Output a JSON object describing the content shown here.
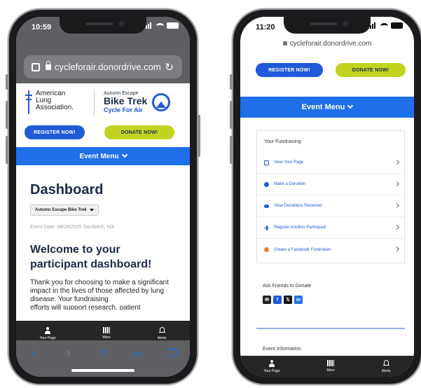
{
  "colors": {
    "brand_blue": "#1f5ad8",
    "event_menu_blue": "#1f6fe8",
    "donate_green": "#c2d421",
    "navy_text": "#1b2a48",
    "tab_bar": "#262626"
  },
  "phone1": {
    "status": {
      "time": "10:59"
    },
    "address": {
      "url": "cycleforair.donordrive.com",
      "page_icon": "page-icon",
      "lock_icon": "lock-icon",
      "reload_icon": "reload-icon"
    },
    "logo_ala": {
      "line1": "American",
      "line2": "Lung",
      "line3": "Association."
    },
    "logo_bt": {
      "small": "Autumn Escape",
      "big": "Bike Trek",
      "sub": "Cycle For Air"
    },
    "buttons": {
      "register": "REGISTER NOW!",
      "donate": "DONATE NOW!"
    },
    "event_menu": "Event Menu",
    "dashboard": {
      "title": "Dashboard",
      "event_select": "Autumn Escape Bike Trek",
      "event_date": "Event Date: 09/26/2025   Sandwich, MA",
      "welcome": "Welcome to your participant dashboard!",
      "intro": "Thank you for choosing to make a significant impact in the lives of those affected by lung disease. Your fundraising",
      "intro_cut": "efforts will support research, patient"
    },
    "tabs": [
      {
        "label": "Your Page",
        "icon": "person-icon"
      },
      {
        "label": "More",
        "icon": "grid-icon"
      },
      {
        "label": "Alerts",
        "icon": "bell-icon"
      }
    ],
    "safari": {
      "back": "‹",
      "forward": "›",
      "share": "⇧",
      "bookmarks": "▭",
      "tabs": "❐"
    }
  },
  "phone2": {
    "status": {
      "time": "11:20"
    },
    "address": {
      "url": "cycleforair.donordrive.com"
    },
    "buttons": {
      "register": "REGISTER NOW!",
      "donate": "DONATE NOW!"
    },
    "event_menu": "Event Menu",
    "fundraising": {
      "heading": "Your Fundraising",
      "items": [
        {
          "label": "View Your Page",
          "icon": "page-icon"
        },
        {
          "label": "Make a Donation",
          "icon": "dollar-icon"
        },
        {
          "label": "View Donations Received",
          "icon": "eye-icon"
        },
        {
          "label": "Register Another Participant",
          "icon": "plus-icon"
        },
        {
          "label": "Create a Facebook Fundraiser",
          "icon": "facebook-icon"
        }
      ]
    },
    "ask": {
      "heading": "Ask Friends to Donate",
      "email": "✉",
      "facebook": "f",
      "x": "𝕏",
      "linkedin": "in"
    },
    "event_info": "Event Information",
    "tabs": [
      {
        "label": "Your Page",
        "icon": "person-icon"
      },
      {
        "label": "More",
        "icon": "grid-icon"
      },
      {
        "label": "Alerts",
        "icon": "bell-icon"
      }
    ]
  }
}
